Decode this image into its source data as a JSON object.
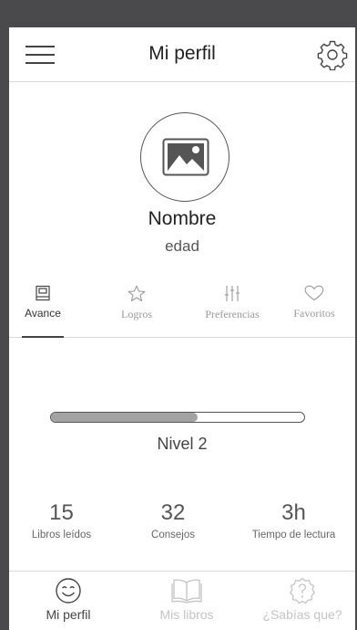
{
  "header": {
    "title": "Mi perfil"
  },
  "profile": {
    "name": "Nombre",
    "age": "edad"
  },
  "tabs": [
    {
      "label": "Avance",
      "icon": "book-icon",
      "active": true
    },
    {
      "label": "Logros",
      "icon": "star-icon",
      "active": false
    },
    {
      "label": "Preferencias",
      "icon": "sliders-icon",
      "active": false
    },
    {
      "label": "Favoritos",
      "icon": "heart-icon",
      "active": false
    }
  ],
  "progress": {
    "fraction": 0.58,
    "level_label": "Nivel 2"
  },
  "stats": [
    {
      "value": "15",
      "label": "Libros leídos"
    },
    {
      "value": "32",
      "label": "Consejos"
    },
    {
      "value": "3h",
      "label": "Tiempo de lectura"
    }
  ],
  "bottom_nav": [
    {
      "label": "Mi perfil",
      "icon": "smiley-icon",
      "active": true
    },
    {
      "label": "Mis libros",
      "icon": "open-book-icon",
      "active": false
    },
    {
      "label": "¿Sabías que?",
      "icon": "question-badge-icon",
      "active": false
    }
  ],
  "colors": {
    "frame": "#4a4a4d",
    "progress_fill": "#a3a3a3",
    "inactive": "#c4c4c4"
  }
}
